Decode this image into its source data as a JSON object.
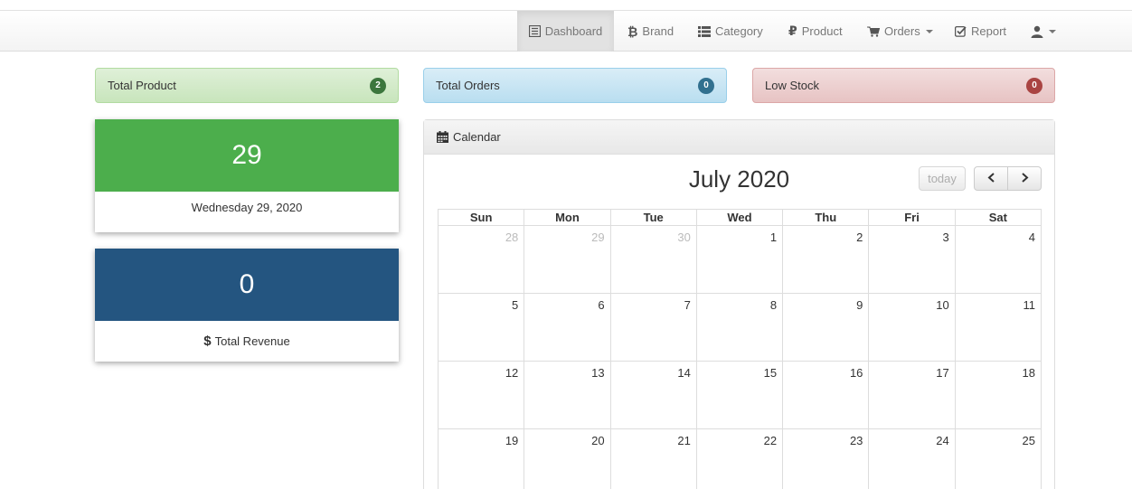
{
  "nav": {
    "items": [
      {
        "label": "Dashboard",
        "icon": "dashboard-icon",
        "active": true
      },
      {
        "label": "Brand",
        "icon": "bitcoin-icon"
      },
      {
        "label": "Category",
        "icon": "list-icon"
      },
      {
        "label": "Product",
        "icon": "ruble-icon"
      },
      {
        "label": "Orders",
        "icon": "cart-icon"
      },
      {
        "label": "Report",
        "icon": "check-square-icon"
      },
      {
        "label": "",
        "icon": "user-icon"
      }
    ]
  },
  "alerts": {
    "total_product": {
      "label": "Total Product",
      "count": "2"
    },
    "total_orders": {
      "label": "Total Orders",
      "count": "0"
    },
    "low_stock": {
      "label": "Low Stock",
      "count": "0"
    }
  },
  "date_card": {
    "value": "29",
    "label": "Wednesday 29, 2020"
  },
  "revenue_card": {
    "value": "0",
    "currency": "$",
    "label": "Total Revenue"
  },
  "calendar": {
    "heading": "Calendar",
    "title": "July 2020",
    "today_label": "today",
    "prev_label": "<",
    "next_label": ">",
    "weekdays": [
      "Sun",
      "Mon",
      "Tue",
      "Wed",
      "Thu",
      "Fri",
      "Sat"
    ],
    "weeks": [
      [
        {
          "d": "28",
          "other": true
        },
        {
          "d": "29",
          "other": true
        },
        {
          "d": "30",
          "other": true
        },
        {
          "d": "1"
        },
        {
          "d": "2"
        },
        {
          "d": "3"
        },
        {
          "d": "4"
        }
      ],
      [
        {
          "d": "5"
        },
        {
          "d": "6"
        },
        {
          "d": "7"
        },
        {
          "d": "8"
        },
        {
          "d": "9"
        },
        {
          "d": "10"
        },
        {
          "d": "11"
        }
      ],
      [
        {
          "d": "12"
        },
        {
          "d": "13"
        },
        {
          "d": "14"
        },
        {
          "d": "15"
        },
        {
          "d": "16"
        },
        {
          "d": "17"
        },
        {
          "d": "18"
        }
      ],
      [
        {
          "d": "19"
        },
        {
          "d": "20"
        },
        {
          "d": "21"
        },
        {
          "d": "22"
        },
        {
          "d": "23"
        },
        {
          "d": "24"
        },
        {
          "d": "25"
        }
      ]
    ]
  },
  "colors": {
    "success_card": "#4cae4c",
    "revenue_card": "#245580",
    "alert_success": "#dff0d8",
    "alert_info": "#d9edf7",
    "alert_danger": "#f2dede"
  }
}
